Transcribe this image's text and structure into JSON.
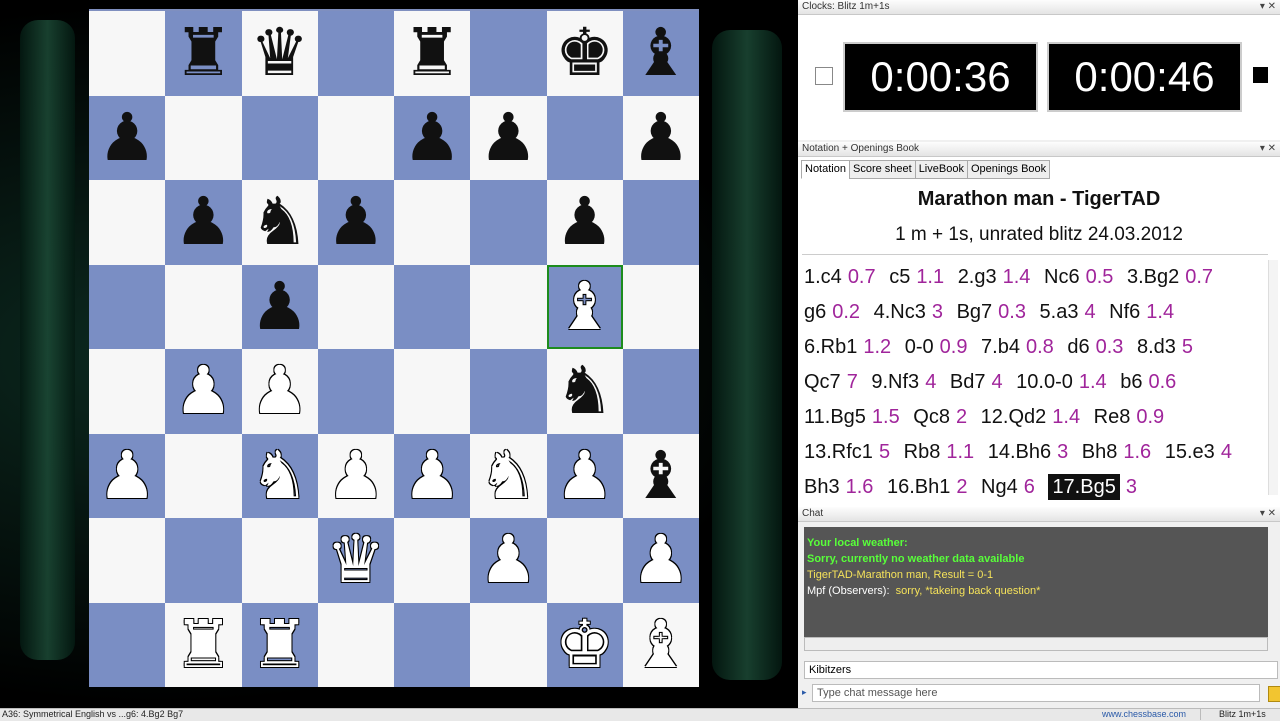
{
  "clocks": {
    "title": "Clocks: Blitz 1m+1s",
    "left_time": "0:00:36",
    "right_time": "0:00:46"
  },
  "notation_panel": {
    "title": "Notation + Openings Book",
    "tabs": [
      "Notation",
      "Score sheet",
      "LiveBook",
      "Openings Book"
    ],
    "game_title": "Marathon man - TigerTAD",
    "game_subtitle": "1 m + 1s, unrated blitz 24.03.2012",
    "moves": [
      [
        "1.c4",
        "0.7"
      ],
      [
        "c5",
        "1.1"
      ],
      [
        "2.g3",
        "1.4"
      ],
      [
        "Nc6",
        "0.5"
      ],
      [
        "3.Bg2",
        "0.7"
      ],
      [
        "g6",
        "0.2"
      ],
      [
        "4.Nc3",
        "3"
      ],
      [
        "Bg7",
        "0.3"
      ],
      [
        "5.a3",
        "4"
      ],
      [
        "Nf6",
        "1.4"
      ],
      [
        "6.Rb1",
        "1.2"
      ],
      [
        "0-0",
        "0.9"
      ],
      [
        "7.b4",
        "0.8"
      ],
      [
        "d6",
        "0.3"
      ],
      [
        "8.d3",
        "5"
      ],
      [
        "Qc7",
        "7"
      ],
      [
        "9.Nf3",
        "4"
      ],
      [
        "Bd7",
        "4"
      ],
      [
        "10.0-0",
        "1.4"
      ],
      [
        "b6",
        "0.6"
      ],
      [
        "11.Bg5",
        "1.5"
      ],
      [
        "Qc8",
        "2"
      ],
      [
        "12.Qd2",
        "1.4"
      ],
      [
        "Re8",
        "0.9"
      ],
      [
        "13.Rfc1",
        "5"
      ],
      [
        "Rb8",
        "1.1"
      ],
      [
        "14.Bh6",
        "3"
      ],
      [
        "Bh8",
        "1.6"
      ],
      [
        "15.e3",
        "4"
      ],
      [
        "Bh3",
        "1.6"
      ],
      [
        "16.Bh1",
        "2"
      ],
      [
        "Ng4",
        "6"
      ],
      [
        "17.Bg5",
        "3"
      ]
    ],
    "current_move_index": 32
  },
  "chat": {
    "title": "Chat",
    "lines": [
      {
        "text": "Your local weather:",
        "style": "green"
      },
      {
        "text": "Sorry, currently no weather data available",
        "style": "green"
      },
      {
        "text": "TigerTAD-Marathon man, Result = 0-1",
        "style": "yellow"
      },
      {
        "speaker": "Mpf (Observers):",
        "text": "sorry, *takeing back question*",
        "style": "mixed"
      }
    ],
    "channel": "Kibitzers",
    "input_placeholder": "Type chat message here"
  },
  "status_bar": {
    "opening": "A36: Symmetrical English vs ...g6: 4.Bg2 Bg7",
    "link": "www.chessbase.com",
    "clock_mode": "Blitz 1m+1s"
  },
  "board": {
    "ranks": [
      [
        "",
        "bR",
        "bQ",
        "",
        "bR",
        "",
        "bK",
        "bB"
      ],
      [
        "bP",
        "",
        "",
        "",
        "bP",
        "bP",
        "",
        "bP"
      ],
      [
        "",
        "bP",
        "bN",
        "bP",
        "",
        "",
        "bP",
        ""
      ],
      [
        "",
        "",
        "bP",
        "",
        "",
        "",
        "wB",
        ""
      ],
      [
        "",
        "wP",
        "wP",
        "",
        "",
        "",
        "bN",
        ""
      ],
      [
        "wP",
        "",
        "wN",
        "wP",
        "wP",
        "wN",
        "wP",
        "bB"
      ],
      [
        "",
        "",
        "",
        "wQ",
        "",
        "wP",
        "",
        "wP"
      ],
      [
        "",
        "wR",
        "wR",
        "",
        "",
        "",
        "wK",
        "wB"
      ]
    ],
    "highlight": [
      3,
      6
    ]
  }
}
